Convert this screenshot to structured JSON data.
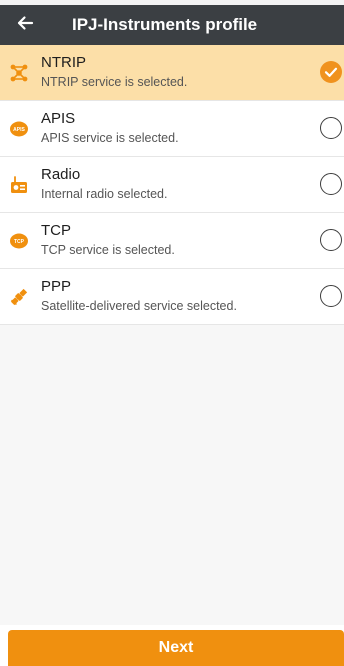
{
  "header": {
    "title": "IPJ-Instruments profile",
    "back_icon": "arrow-left-icon"
  },
  "colors": {
    "accent": "#f0900f",
    "header_bg": "#3b3f43",
    "selected_row_bg": "#fcdfa8"
  },
  "services": [
    {
      "title": "NTRIP",
      "subtitle": "NTRIP service is selected.",
      "icon": "network-icon",
      "selected": true
    },
    {
      "title": "APIS",
      "subtitle": "APIS service is selected.",
      "icon": "apis-icon",
      "icon_text": "APIS",
      "selected": false
    },
    {
      "title": "Radio",
      "subtitle": "Internal radio selected.",
      "icon": "radio-icon",
      "selected": false
    },
    {
      "title": "TCP",
      "subtitle": "TCP service is selected.",
      "icon": "tcp-icon",
      "icon_text": "TCP",
      "selected": false
    },
    {
      "title": "PPP",
      "subtitle": "Satellite-delivered service selected.",
      "icon": "satellite-icon",
      "selected": false
    }
  ],
  "footer": {
    "next_label": "Next"
  }
}
